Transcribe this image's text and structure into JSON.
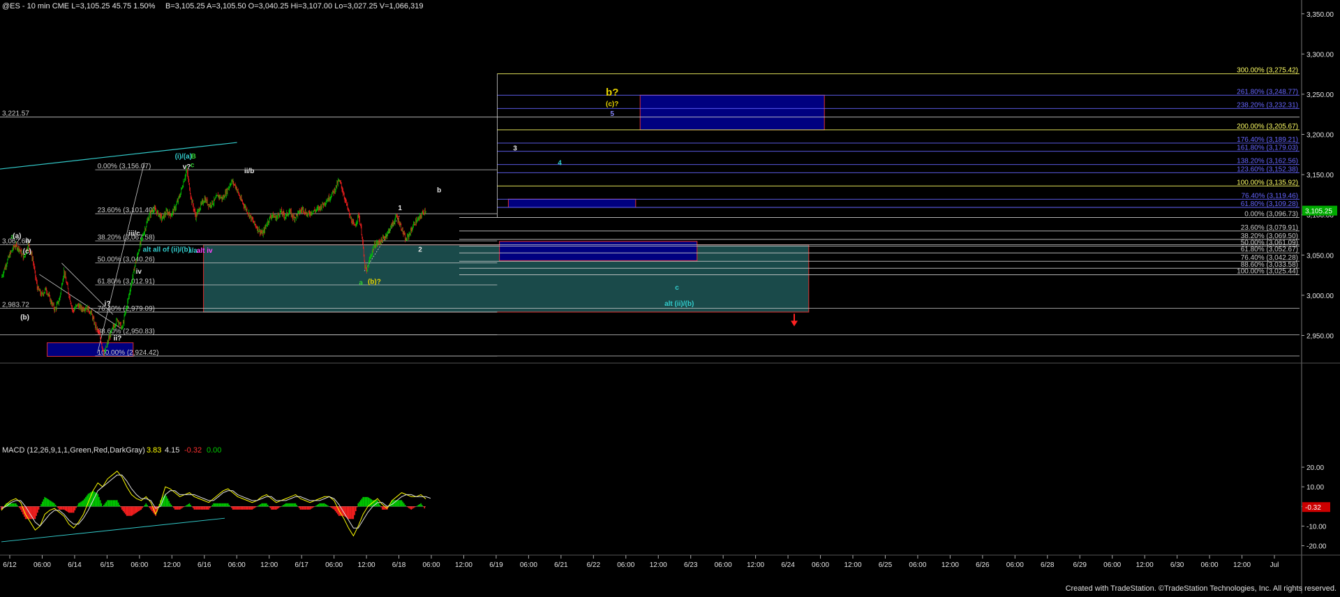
{
  "header": {
    "symbol": "@ES - 10 min  CME  L=3,105.25  45.75  1.50%",
    "quote": "B=3,105.25  A=3,105.50  O=3,040.25  Hi=3,107.00  Lo=3,027.25  V=1,066,319"
  },
  "footer": {
    "credit": "Created with TradeStation. ©TradeStation Technologies, Inc. All rights reserved."
  },
  "macd_header": {
    "label": "MACD (12,26,9,1,1,Green,Red,DarkGray)",
    "v1": "3.83",
    "v2": "4.15",
    "v3": "-0.32",
    "v4": "0.00"
  },
  "colors": {
    "background": "#000000",
    "bull_candle": "#00cc00",
    "bear_candle": "#ff2020",
    "macd_line": "#ffff00",
    "signal_line": "#e0e0e0",
    "fib_yellow": "#ffff66",
    "fib_blue": "#6666ff",
    "fib_white": "#cccccc",
    "box_navy": "#000080",
    "box_teal": "#1a4a4a",
    "trend_cyan": "#33cccc",
    "wave_green": "#33cc33",
    "wave_cyan": "#33cccc",
    "wave_yellow": "#e6d200",
    "wave_magenta": "#ff44ff",
    "down_arrow": "#ff2222"
  },
  "chart_data": [
    {
      "type": "candlestick",
      "symbol": "@ES",
      "interval": "10 min",
      "x_ticks": [
        "6/12",
        "06:00",
        "6/14",
        "6/15",
        "06:00",
        "12:00",
        "6/16",
        "06:00",
        "12:00",
        "6/17",
        "06:00",
        "12:00",
        "6/18",
        "06:00",
        "12:00",
        "6/19",
        "06:00",
        "6/21",
        "6/22",
        "06:00",
        "12:00",
        "6/23",
        "06:00",
        "12:00",
        "6/24",
        "06:00",
        "12:00",
        "6/25",
        "06:00",
        "12:00",
        "6/26",
        "06:00",
        "6/28",
        "6/29",
        "06:00",
        "12:00",
        "6/30",
        "06:00",
        "12:00",
        "Jul"
      ],
      "y_ticks": [
        "3,350.00",
        "3,300.00",
        "3,250.00",
        "3,200.00",
        "3,150.00",
        "3,100.00",
        "3,050.00",
        "3,000.00",
        "2,950.00"
      ],
      "ylim": [
        2920,
        3355
      ],
      "last_price": "3,105.25",
      "price_path": [
        [
          0,
          3022
        ],
        [
          4,
          3038
        ],
        [
          8,
          3052
        ],
        [
          12,
          3062
        ],
        [
          16,
          3058
        ],
        [
          20,
          3046
        ],
        [
          24,
          3063
        ],
        [
          28,
          3045
        ],
        [
          32,
          3010
        ],
        [
          36,
          3000
        ],
        [
          40,
          3008
        ],
        [
          44,
          2993
        ],
        [
          48,
          2982
        ],
        [
          52,
          2995
        ],
        [
          56,
          3030
        ],
        [
          60,
          3004
        ],
        [
          64,
          2980
        ],
        [
          68,
          2988
        ],
        [
          72,
          2983
        ],
        [
          76,
          2985
        ],
        [
          80,
          2979
        ],
        [
          84,
          2962
        ],
        [
          88,
          2950
        ],
        [
          92,
          2926
        ],
        [
          96,
          2945
        ],
        [
          100,
          2960
        ],
        [
          104,
          2970
        ],
        [
          108,
          2958
        ],
        [
          112,
          2985
        ],
        [
          116,
          3012
        ],
        [
          120,
          3040
        ],
        [
          124,
          3062
        ],
        [
          128,
          3080
        ],
        [
          132,
          3098
        ],
        [
          136,
          3108
        ],
        [
          140,
          3102
        ],
        [
          144,
          3095
        ],
        [
          148,
          3104
        ],
        [
          152,
          3100
        ],
        [
          156,
          3110
        ],
        [
          160,
          3125
        ],
        [
          164,
          3146
        ],
        [
          166,
          3155
        ],
        [
          170,
          3120
        ],
        [
          174,
          3098
        ],
        [
          178,
          3110
        ],
        [
          182,
          3120
        ],
        [
          186,
          3112
        ],
        [
          190,
          3116
        ],
        [
          194,
          3124
        ],
        [
          198,
          3120
        ],
        [
          202,
          3130
        ],
        [
          206,
          3142
        ],
        [
          210,
          3135
        ],
        [
          214,
          3120
        ],
        [
          218,
          3110
        ],
        [
          222,
          3100
        ],
        [
          226,
          3090
        ],
        [
          230,
          3082
        ],
        [
          234,
          3076
        ],
        [
          238,
          3090
        ],
        [
          242,
          3100
        ],
        [
          246,
          3096
        ],
        [
          250,
          3104
        ],
        [
          254,
          3098
        ],
        [
          258,
          3104
        ],
        [
          262,
          3096
        ],
        [
          266,
          3102
        ],
        [
          270,
          3108
        ],
        [
          274,
          3100
        ],
        [
          278,
          3104
        ],
        [
          282,
          3106
        ],
        [
          286,
          3110
        ],
        [
          290,
          3116
        ],
        [
          294,
          3122
        ],
        [
          298,
          3130
        ],
        [
          302,
          3142
        ],
        [
          304,
          3138
        ],
        [
          308,
          3118
        ],
        [
          312,
          3098
        ],
        [
          316,
          3085
        ],
        [
          320,
          3100
        ],
        [
          323,
          3074
        ],
        [
          325,
          3040
        ],
        [
          327,
          3028
        ],
        [
          330,
          3046
        ],
        [
          334,
          3062
        ],
        [
          338,
          3066
        ],
        [
          342,
          3070
        ],
        [
          346,
          3078
        ],
        [
          350,
          3088
        ],
        [
          354,
          3098
        ],
        [
          358,
          3085
        ],
        [
          362,
          3068
        ],
        [
          366,
          3078
        ],
        [
          370,
          3090
        ],
        [
          374,
          3095
        ],
        [
          378,
          3104
        ],
        [
          380,
          3106
        ]
      ]
    },
    {
      "type": "annotations",
      "fib_levels_left": [
        {
          "label": "0.00% (3,156.07)",
          "price": 3156.07
        },
        {
          "label": "23.60% (3,101.40)",
          "price": 3101.4
        },
        {
          "label": "38.20% (3,067.58)",
          "price": 3067.58
        },
        {
          "label": "50.00% (3,040.26)",
          "price": 3040.26
        },
        {
          "label": "61.80% (3,012.91)",
          "price": 3012.91
        },
        {
          "label": "76.40% (2,979.09)",
          "price": 2979.09
        },
        {
          "label": "88.60% (2,950.83)",
          "price": 2950.83
        },
        {
          "label": "100.00% (2,924.42)",
          "price": 2924.42
        }
      ],
      "fib_levels_right_low": [
        {
          "label": "0.00% (3,096.73)",
          "price": 3096.73
        },
        {
          "label": "23.60% (3,079.91)",
          "price": 3079.91
        },
        {
          "label": "38.20% (3,069.50)",
          "price": 3069.5
        },
        {
          "label": "50.00% (3,061.09)",
          "price": 3061.09
        },
        {
          "label": "61.80% (3,052.67)",
          "price": 3052.67
        },
        {
          "label": "76.40% (3,042.28)",
          "price": 3042.28
        },
        {
          "label": "88.60% (3,033.58)",
          "price": 3033.58
        },
        {
          "label": "100.00% (3,025.44)",
          "price": 3025.44
        }
      ],
      "fib_levels_right_high": [
        {
          "label": "300.00% (3,275.42)",
          "price": 3275.42,
          "color": "yellow"
        },
        {
          "label": "261.80% (3,248.77)",
          "price": 3248.77,
          "color": "blue"
        },
        {
          "label": "238.20% (3,232.31)",
          "price": 3232.31,
          "color": "blue"
        },
        {
          "label": "200.00% (3,205.67)",
          "price": 3205.67,
          "color": "yellow"
        },
        {
          "label": "176.40% (3,189.21)",
          "price": 3189.21,
          "color": "blue"
        },
        {
          "label": "161.80% (3,179.03)",
          "price": 3179.03,
          "color": "blue"
        },
        {
          "label": "138.20% (3,162.56)",
          "price": 3162.56,
          "color": "blue"
        },
        {
          "label": "123.60% (3,152.38)",
          "price": 3152.38,
          "color": "blue"
        },
        {
          "label": "100.00% (3,135.92)",
          "price": 3135.92,
          "color": "yellow"
        },
        {
          "label": "76.40% (3,119.46)",
          "price": 3119.46,
          "color": "blue"
        },
        {
          "label": "61.80% (3,109.28)",
          "price": 3109.28,
          "color": "blue"
        }
      ],
      "price_levels": [
        {
          "label": "3,221.57",
          "price": 3221.57
        },
        {
          "label": "3,062.69",
          "price": 3062.69
        },
        {
          "label": "2,983.72",
          "price": 2983.72
        }
      ],
      "wave_labels": [
        {
          "text": "a",
          "x": 10,
          "price": 3070,
          "color": "green"
        },
        {
          "text": "(a)",
          "x": 14,
          "price": 3071,
          "color": "white"
        },
        {
          "text": "iv",
          "x": 24,
          "price": 3065,
          "color": "white"
        },
        {
          "text": "(c)",
          "x": 23,
          "price": 3052,
          "color": "white"
        },
        {
          "text": "(b)",
          "x": 21,
          "price": 2970,
          "color": "white"
        },
        {
          "text": "i?",
          "x": 95,
          "price": 2987,
          "color": "white"
        },
        {
          "text": "ii?",
          "x": 104,
          "price": 2944,
          "color": "white"
        },
        {
          "text": "iii/c",
          "x": 119,
          "price": 3074,
          "color": "white"
        },
        {
          "text": "iv",
          "x": 123,
          "price": 3027,
          "color": "white"
        },
        {
          "text": "(i)/(a)",
          "x": 163,
          "price": 3170,
          "color": "cyan"
        },
        {
          "text": "B",
          "x": 172,
          "price": 3170,
          "color": "green"
        },
        {
          "text": "c",
          "x": 171,
          "price": 3159,
          "color": "green"
        },
        {
          "text": "v?",
          "x": 166,
          "price": 3157,
          "color": "white"
        },
        {
          "text": "ii/b",
          "x": 222,
          "price": 3152,
          "color": "white"
        },
        {
          "text": "i/a",
          "x": 172,
          "price": 3053,
          "color": "cyan"
        },
        {
          "text": "alt iv",
          "x": 182,
          "price": 3053,
          "color": "magenta"
        },
        {
          "text": "alt all of (ii)/(b)",
          "x": 148,
          "price": 3054,
          "color": "cyan"
        },
        {
          "text": "a",
          "x": 322,
          "price": 3013,
          "color": "green"
        },
        {
          "text": "(b)?",
          "x": 334,
          "price": 3014,
          "color": "yellow"
        },
        {
          "text": "1",
          "x": 357,
          "price": 3106,
          "color": "white"
        },
        {
          "text": "2",
          "x": 375,
          "price": 3054,
          "color": "white"
        },
        {
          "text": "b",
          "x": 392,
          "price": 3128,
          "color": "white"
        },
        {
          "text": "3",
          "x": 460,
          "price": 3180,
          "color": "white"
        },
        {
          "text": "4",
          "x": 500,
          "price": 3162,
          "color": "cyan"
        },
        {
          "text": "b?",
          "x": 547,
          "price": 3248,
          "color": "yellow"
        },
        {
          "text": "(c)?",
          "x": 547,
          "price": 3235,
          "color": "yellow"
        },
        {
          "text": "5",
          "x": 547,
          "price": 3223,
          "color": "blue"
        },
        {
          "text": "c",
          "x": 605,
          "price": 3007,
          "color": "cyan"
        },
        {
          "text": "alt (ii)/(b)",
          "x": 607,
          "price": 2987,
          "color": "cyan"
        }
      ]
    },
    {
      "type": "line",
      "name": "MACD",
      "ylim": [
        -23,
        25
      ],
      "y_ticks": [
        "20.00",
        "10.00",
        "0.00",
        "-10.00",
        "-20.00"
      ],
      "current_value": "-0.32",
      "series": [
        {
          "name": "MACD",
          "values": [
            -2,
            1,
            3,
            4,
            2,
            -4,
            -8,
            -12,
            -10,
            -4,
            -2,
            -1,
            -3,
            -5,
            -9,
            -11,
            -8,
            -4,
            2,
            8,
            12,
            10,
            14,
            16,
            18,
            15,
            10,
            6,
            4,
            3,
            5,
            2,
            -4,
            2,
            10,
            9,
            7,
            5,
            6,
            7,
            5,
            4,
            3,
            2,
            4,
            6,
            8,
            9,
            7,
            5,
            4,
            3,
            2,
            3,
            5,
            6,
            4,
            2,
            3,
            4,
            5,
            6,
            4,
            3,
            2,
            3,
            4,
            5,
            5,
            3,
            -2,
            -6,
            -11,
            -15,
            -10,
            -4,
            0,
            2,
            4,
            1,
            -1,
            3,
            5,
            7,
            6,
            5,
            5,
            6,
            3.83
          ]
        },
        {
          "name": "Signal",
          "values": [
            -1,
            0,
            2,
            3,
            3,
            0,
            -4,
            -8,
            -10,
            -7,
            -4,
            -2,
            -2,
            -4,
            -7,
            -9,
            -9,
            -6,
            -2,
            3,
            8,
            10,
            12,
            14,
            16,
            16,
            13,
            9,
            6,
            4,
            4,
            3,
            -1,
            0,
            6,
            8,
            8,
            6,
            6,
            6,
            6,
            5,
            4,
            3,
            3,
            5,
            7,
            8,
            8,
            6,
            5,
            4,
            3,
            3,
            4,
            5,
            5,
            3,
            3,
            3,
            4,
            5,
            5,
            4,
            3,
            3,
            3,
            4,
            5,
            4,
            1,
            -3,
            -7,
            -11,
            -11,
            -7,
            -3,
            0,
            2,
            2,
            0,
            1,
            3,
            5,
            6,
            6,
            5,
            5,
            5,
            4.15
          ]
        }
      ]
    }
  ]
}
